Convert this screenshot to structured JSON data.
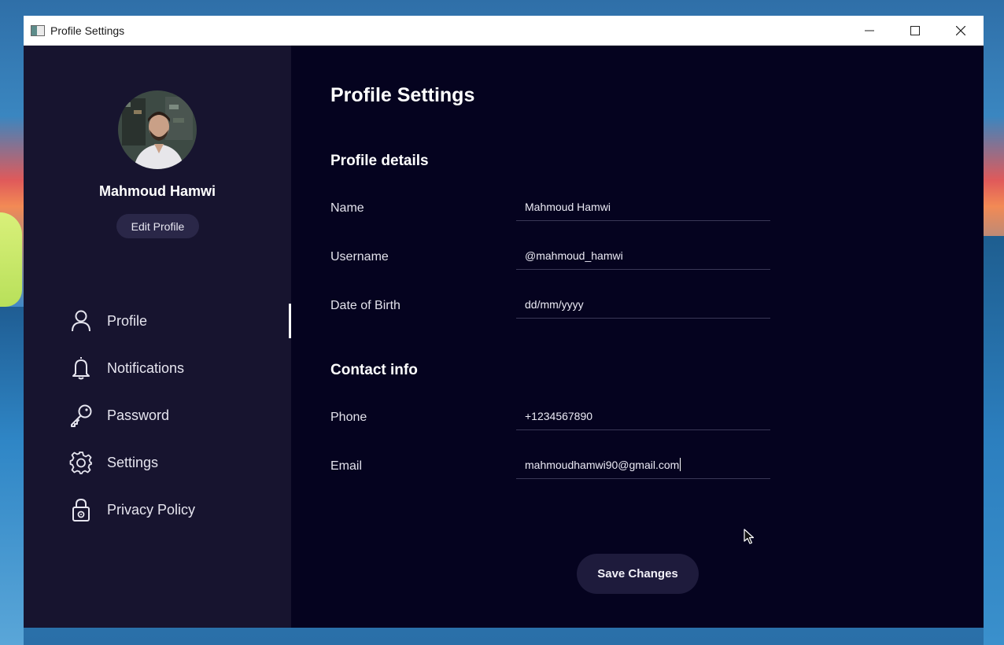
{
  "window": {
    "title": "Profile Settings",
    "controls": [
      "minimize-icon",
      "maximize-icon",
      "close-icon"
    ]
  },
  "sidebar": {
    "user_name": "Mahmoud Hamwi",
    "edit_profile_label": "Edit Profile",
    "items": [
      {
        "label": "Profile",
        "icon": "user-icon",
        "active": true
      },
      {
        "label": "Notifications",
        "icon": "bell-icon",
        "active": false
      },
      {
        "label": "Password",
        "icon": "key-icon",
        "active": false
      },
      {
        "label": "Settings",
        "icon": "gear-icon",
        "active": false
      },
      {
        "label": "Privacy Policy",
        "icon": "lock-icon",
        "active": false
      }
    ]
  },
  "main": {
    "page_title": "Profile Settings",
    "profile_section": {
      "title": "Profile details",
      "fields": [
        {
          "label": "Name",
          "value": "Mahmoud Hamwi"
        },
        {
          "label": "Username",
          "value": "@mahmoud_hamwi"
        },
        {
          "label": "Date of Birth",
          "value": "dd/mm/yyyy"
        }
      ]
    },
    "contact_section": {
      "title": "Contact info",
      "fields": [
        {
          "label": "Phone",
          "value": "+1234567890"
        },
        {
          "label": "Email",
          "value": "mahmoudhamwi90@gmail.com"
        }
      ]
    },
    "save_label": "Save Changes"
  },
  "colors": {
    "window_bg": "#05031f",
    "sidebar_bg": "#17142f",
    "button_bg": "#1e1b3c",
    "accent": "#ffffff"
  }
}
